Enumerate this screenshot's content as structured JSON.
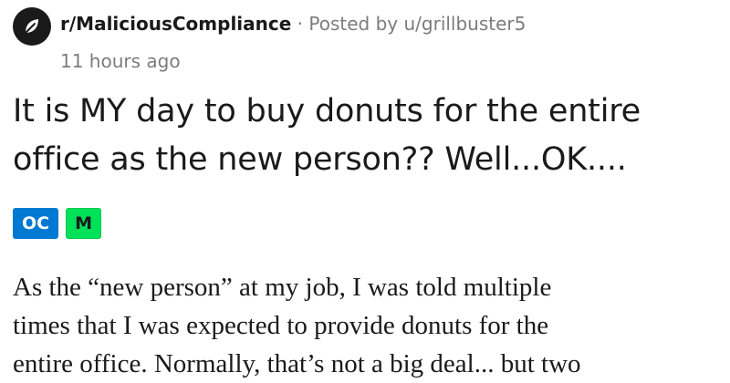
{
  "post": {
    "subreddit": "r/MaliciousCompliance",
    "separator": "·",
    "posted_by_prefix": "Posted by",
    "author": "u/grillbuster5",
    "time_ago": "11 hours ago",
    "title": "It is MY day to buy donuts for the entire office as the new person?? Well...OK....",
    "flairs": [
      "OC",
      "M"
    ],
    "body_lines": [
      "As the “new person” at my job, I was told multiple",
      "times that I was expected to provide donuts for the",
      "entire office. Normally, that’s not a big deal... but two"
    ]
  },
  "icons": {
    "subreddit_icon": "leaf-icon"
  },
  "colors": {
    "oc_flair": "#0079d3",
    "m_flair": "#00e15a",
    "meta_gray": "#7c7c7c",
    "text": "#1a1a1b"
  }
}
